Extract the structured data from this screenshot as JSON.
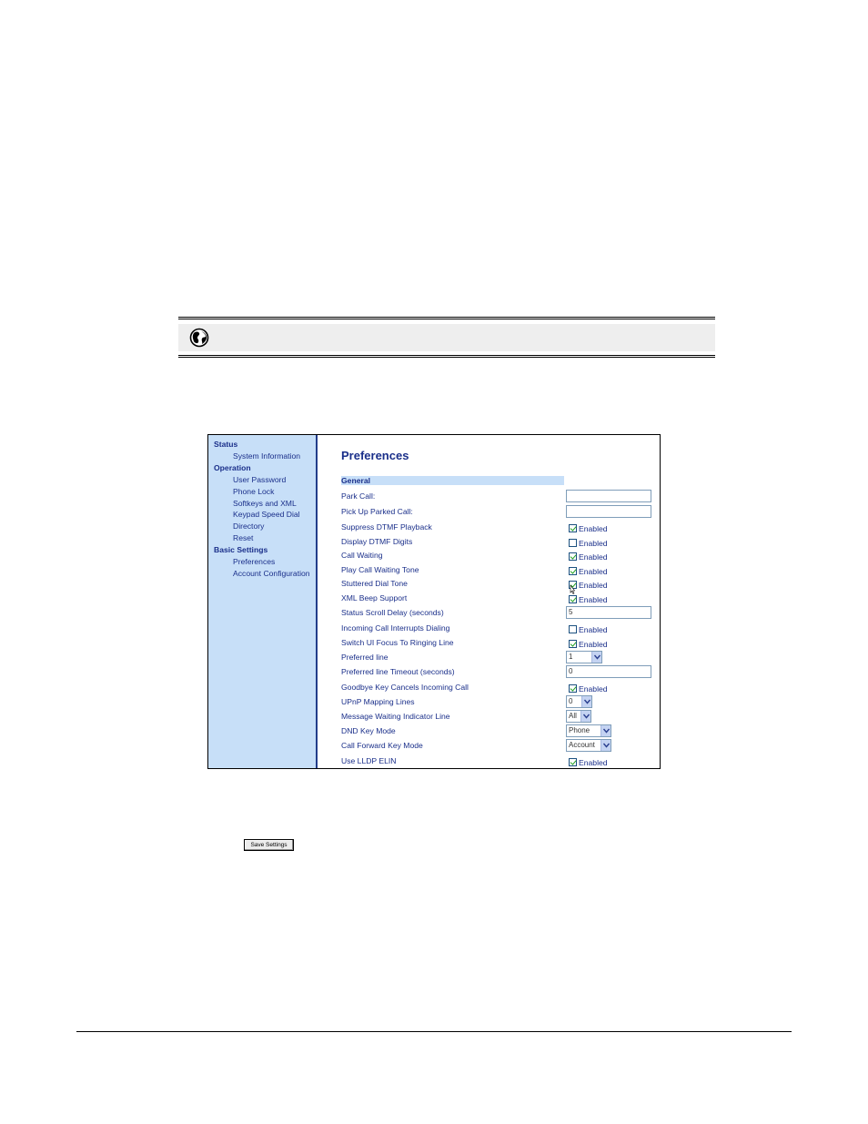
{
  "sidebar": {
    "sections": [
      {
        "label": "Status",
        "items": [
          "System Information"
        ]
      },
      {
        "label": "Operation",
        "items": [
          "User Password",
          "Phone Lock",
          "Softkeys and XML",
          "Keypad Speed Dial",
          "Directory",
          "Reset"
        ]
      },
      {
        "label": "Basic Settings",
        "items": [
          "Preferences",
          "Account Configuration"
        ]
      }
    ]
  },
  "main": {
    "title": "Preferences",
    "section_header": "General",
    "checkbox_label": "Enabled",
    "rows": [
      {
        "label": "Park Call:",
        "control": "text",
        "value": ""
      },
      {
        "label": "Pick Up Parked Call:",
        "control": "text",
        "value": ""
      },
      {
        "label": "Suppress DTMF Playback",
        "control": "checkbox",
        "checked": true
      },
      {
        "label": "Display DTMF Digits",
        "control": "checkbox",
        "checked": false
      },
      {
        "label": "Call Waiting",
        "control": "checkbox",
        "checked": true
      },
      {
        "label": "Play Call Waiting Tone",
        "control": "checkbox",
        "checked": true
      },
      {
        "label": "Stuttered Dial Tone",
        "control": "checkbox",
        "checked": true
      },
      {
        "label": "XML Beep Support",
        "control": "checkbox",
        "checked": true
      },
      {
        "label": "Status Scroll Delay (seconds)",
        "control": "text",
        "value": "5"
      },
      {
        "label": "Incoming Call Interrupts Dialing",
        "control": "checkbox",
        "checked": false
      },
      {
        "label": "Switch UI Focus To Ringing Line",
        "control": "checkbox",
        "checked": true
      },
      {
        "label": "Preferred line",
        "control": "select",
        "value": "1"
      },
      {
        "label": "Preferred line Timeout (seconds)",
        "control": "text",
        "value": "0"
      },
      {
        "label": "Goodbye Key Cancels Incoming Call",
        "control": "checkbox",
        "checked": true
      },
      {
        "label": "UPnP Mapping Lines",
        "control": "select",
        "value": "0"
      },
      {
        "label": "Message Waiting Indicator Line",
        "control": "select",
        "value": "All"
      },
      {
        "label": "DND Key Mode",
        "control": "select",
        "value": "Phone"
      },
      {
        "label": "Call Forward Key Mode",
        "control": "select",
        "value": "Account"
      },
      {
        "label": "Use LLDP ELIN",
        "control": "checkbox",
        "checked": true
      }
    ]
  },
  "save_button": {
    "label": "Save Settings"
  },
  "icons": {
    "web_ui": "globe-icon"
  },
  "colors": {
    "link_blue": "#1a2f8a",
    "sidebar_bg": "#c7dff8",
    "check_green": "#21a121"
  }
}
